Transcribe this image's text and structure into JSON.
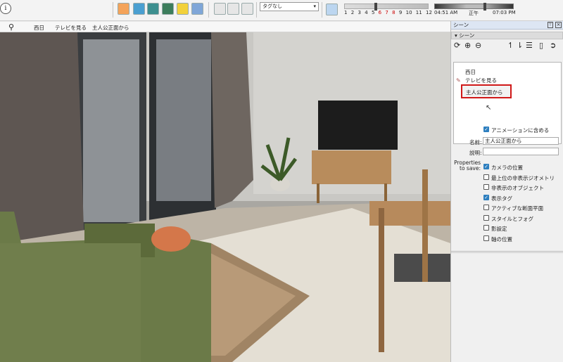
{
  "toolbar": {
    "info_label": "i",
    "tag_select_value": "タグなし",
    "months": [
      "1",
      "2",
      "3",
      "4",
      "5",
      "6",
      "7",
      "8",
      "9",
      "10",
      "11",
      "12"
    ],
    "month_position": 0.36,
    "time_start": "04:51 AM",
    "time_noon": "正午",
    "time_end": "07:03 PM",
    "time_position": 0.63
  },
  "scene_tabs": [
    "西日",
    "テレビを見る",
    "主人公正面から"
  ],
  "panel": {
    "title": "シーン",
    "section": "シーン",
    "scenes": [
      "西日",
      "テレビを見る",
      "主人公正面から"
    ],
    "selected_index": 2,
    "include_in_animation": "アニメーションに含める",
    "name_label": "名前:",
    "name_value": "主人公正面から",
    "description_label": "説明:",
    "description_value": "",
    "properties_label": "Properties\nto save:",
    "properties": [
      {
        "label": "カメラの位置",
        "checked": true
      },
      {
        "label": "最上位の非表示ジオメトリ",
        "checked": false
      },
      {
        "label": "非表示のオブジェクト",
        "checked": false
      },
      {
        "label": "表示タグ",
        "checked": true
      },
      {
        "label": "アクティブな断面平面",
        "checked": false
      },
      {
        "label": "スタイルとフォグ",
        "checked": false
      },
      {
        "label": "影設定",
        "checked": false
      },
      {
        "label": "軸の位置",
        "checked": false
      }
    ]
  },
  "colors": {
    "accent": "#2e7fbf",
    "selection_outline": "#d01818",
    "sofa": "#6b7a48"
  }
}
